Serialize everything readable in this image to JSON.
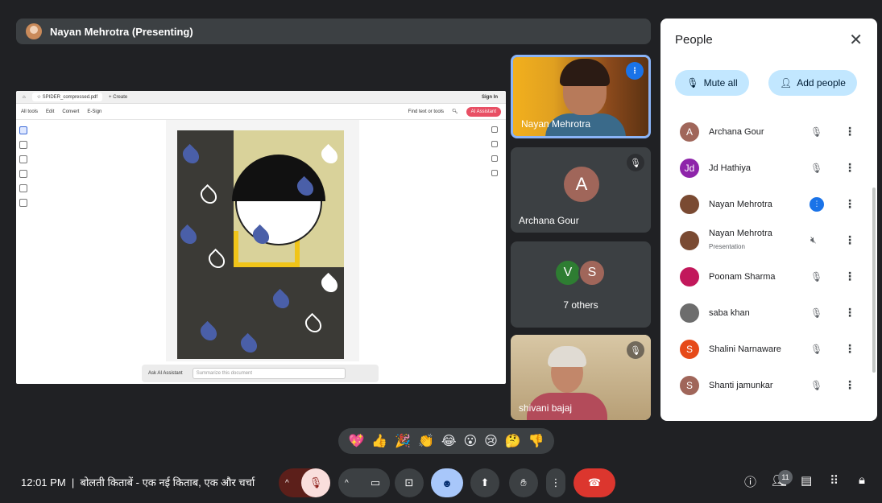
{
  "presenter": {
    "label": "Nayan Mehrotra (Presenting)"
  },
  "shared_screen": {
    "tab_title": "SPIDER_compressed.pdf",
    "new_tab": "+ Create",
    "sign_in": "Sign In",
    "menu": [
      "All tools",
      "Edit",
      "Convert",
      "E-Sign"
    ],
    "find_label": "Find text or tools",
    "ai_button": "AI Assistant",
    "ask_ai": "Ask AI Assistant",
    "ask_placeholder": "Summarize this document"
  },
  "tiles": {
    "nayan": {
      "name": "Nayan Mehrotra"
    },
    "archana": {
      "name": "Archana Gour",
      "initial": "A"
    },
    "others": {
      "initials": [
        "V",
        "S"
      ],
      "label": "7 others"
    },
    "shivani": {
      "name": "shivani bajaj"
    }
  },
  "people_panel": {
    "title": "People",
    "close": "✕",
    "mute_all": "Mute all",
    "add_people": "Add people",
    "participants": [
      {
        "name": "Archana Gour",
        "initial": "A",
        "color": "#a0665a",
        "status": "muted"
      },
      {
        "name": "Jd Hathiya",
        "initial": "Jd",
        "color": "#8e24aa",
        "status": "muted"
      },
      {
        "name": "Nayan Mehrotra",
        "initial": "",
        "color": "#7a4a32",
        "status": "speaking"
      },
      {
        "name": "Nayan Mehrotra",
        "sub": "Presentation",
        "initial": "",
        "color": "#7a4a32",
        "status": "presenting"
      },
      {
        "name": "Poonam Sharma",
        "initial": "",
        "color": "#c2185b",
        "status": "muted"
      },
      {
        "name": "saba khan",
        "initial": "",
        "color": "#6d6d6d",
        "status": "muted"
      },
      {
        "name": "Shalini Narnaware",
        "initial": "S",
        "color": "#e64a19",
        "status": "muted"
      },
      {
        "name": "Shanti jamunkar",
        "initial": "S",
        "color": "#a0665a",
        "status": "muted"
      }
    ]
  },
  "reactions": [
    "💖",
    "👍",
    "🎉",
    "👏",
    "😂",
    "😮",
    "😢",
    "🤔",
    "👎"
  ],
  "bottom": {
    "time": "12:01 PM",
    "separator": "|",
    "meeting_title": "बोलती किताबें - एक नई किताब, एक और चर्चा",
    "participant_count": "11"
  }
}
